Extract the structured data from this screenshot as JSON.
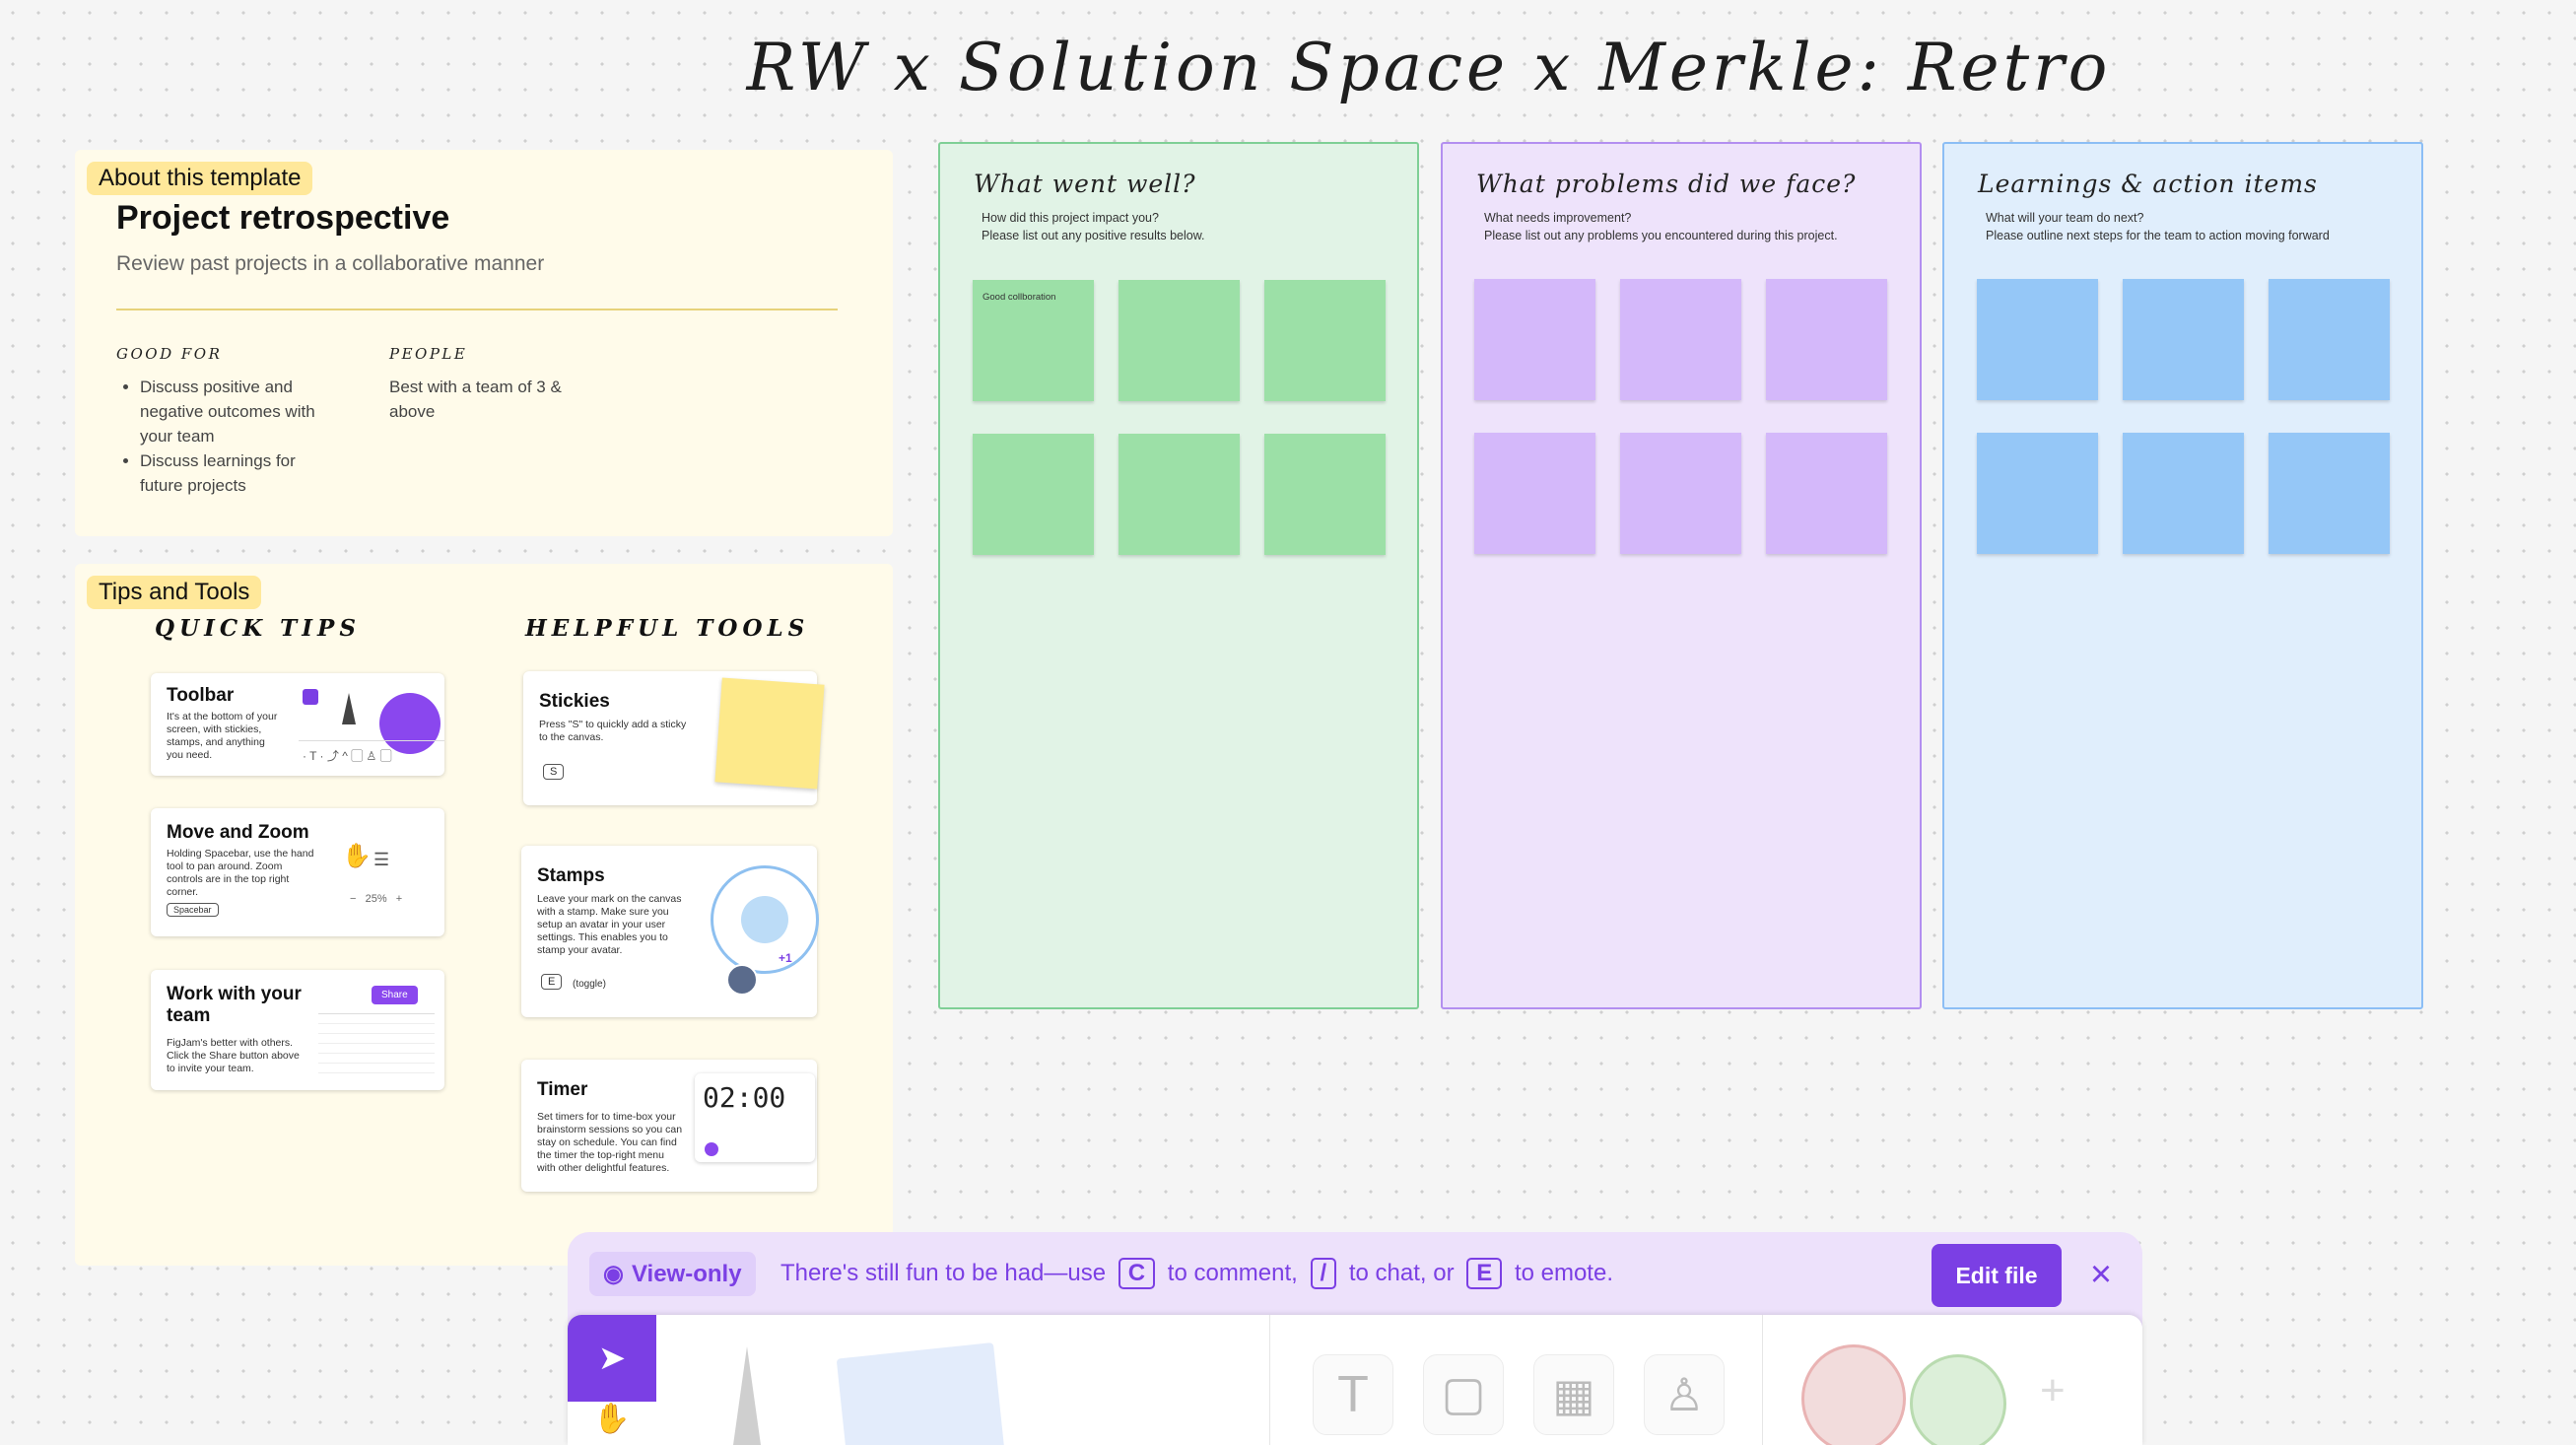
{
  "board": {
    "title": "RW x Solution Space x Merkle: Retro"
  },
  "about": {
    "tag": "About this template",
    "title": "Project retrospective",
    "subtitle": "Review past projects in a collaborative manner",
    "good_for_label": "GOOD FOR",
    "good_for_items": [
      "Discuss positive and negative outcomes with your team",
      "Discuss learnings for future projects"
    ],
    "people_label": "PEOPLE",
    "people_text": "Best with a team of 3 & above"
  },
  "tips": {
    "tag": "Tips and Tools",
    "quick_tips_label": "QUICK TIPS",
    "helpful_tools_label": "HELPFUL TOOLS",
    "toolbar_card": {
      "title": "Toolbar",
      "desc": "It's at the bottom of your screen, with stickies, stamps, and anything you need."
    },
    "move_card": {
      "title": "Move and Zoom",
      "desc": "Holding Spacebar, use the hand tool to pan around. Zoom controls are in the top right corner.",
      "key": "Spacebar",
      "zoom": "25%"
    },
    "team_card": {
      "title": "Work with your team",
      "desc": "FigJam's better with others. Click the Share button above to invite your team.",
      "share": "Share"
    },
    "stickies_card": {
      "title": "Stickies",
      "desc": "Press \"S\" to quickly add a sticky to the canvas.",
      "key": "S"
    },
    "stamps_card": {
      "title": "Stamps",
      "desc": "Leave your mark on the canvas with a stamp. Make sure you setup an avatar in your user settings. This enables you to stamp your avatar.",
      "key": "E",
      "key_note": "(toggle)",
      "badge": "+1"
    },
    "timer_card": {
      "title": "Timer",
      "desc": "Set timers for to time-box your brainstorm sessions so you can stay on schedule. You can find the timer the top-right menu with other delightful features.",
      "time": "02:00"
    }
  },
  "columns": [
    {
      "title": "What went well?",
      "q": "How did this project impact you?",
      "d": "Please list out any positive results below.",
      "bg": "#e1f3e6",
      "border": "#7fcf96",
      "sticky": "#9ce0a7",
      "first_sticky_text": "Good collboration"
    },
    {
      "title": "What problems did we face?",
      "q": "What needs improvement?",
      "d": "Please list out any problems you encountered during this project.",
      "bg": "#eee3fb",
      "border": "#b38ff0",
      "sticky": "#d4b8fa",
      "first_sticky_text": ""
    },
    {
      "title": "Learnings & action items",
      "q": "What will your team do next?",
      "d": "Please outline next steps for the team to action moving forward",
      "bg": "#e0eefc",
      "border": "#8cbef5",
      "sticky": "#95c7f7",
      "first_sticky_text": ""
    }
  ],
  "banner": {
    "view_only": "View-only",
    "text1": "There's still fun to be had—use",
    "key_c": "C",
    "text2": "to comment,",
    "key_slash": "/",
    "text3": "to chat, or",
    "key_e": "E",
    "text4": "to emote.",
    "edit_button": "Edit file"
  },
  "colors": {
    "accent": "#7b3fe4"
  }
}
